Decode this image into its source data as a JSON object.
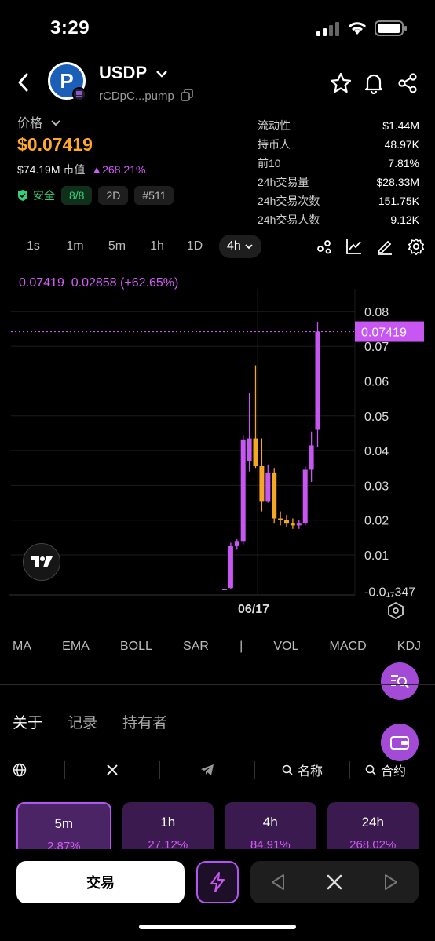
{
  "status_bar": {
    "time": "3:29"
  },
  "token": {
    "symbol": "USDP",
    "logo_letter": "P",
    "address": "rCDpC...pump"
  },
  "price": {
    "label": "价格",
    "value": "$0.07419",
    "market_cap": "$74.19M",
    "market_cap_label": "市值",
    "change": "268.21%"
  },
  "badges": {
    "safe_label": "安全",
    "safe_count": "8/8",
    "age": "2D",
    "rank": "#511"
  },
  "stats": [
    {
      "key": "流动性",
      "value": "$1.44M"
    },
    {
      "key": "持币人",
      "value": "48.97K"
    },
    {
      "key": "前10",
      "value": "7.81%"
    },
    {
      "key": "24h交易量",
      "value": "$28.33M"
    },
    {
      "key": "24h交易次数",
      "value": "151.75K"
    },
    {
      "key": "24h交易人数",
      "value": "9.12K"
    }
  ],
  "timeframes": [
    "1s",
    "1m",
    "5m",
    "1h",
    "1D",
    "4h"
  ],
  "active_timeframe": "4h",
  "chart_header": {
    "price": "0.07419",
    "change_abs": "0.02858",
    "change_pct": "(+62.65%)"
  },
  "chart_data": {
    "type": "candlestick",
    "y_ticks": [
      "0.08",
      "0.07",
      "0.06",
      "0.05",
      "0.04",
      "0.03",
      "0.02",
      "0.01"
    ],
    "y_tick_values": [
      0.08,
      0.07,
      0.06,
      0.05,
      0.04,
      0.03,
      0.02,
      0.01
    ],
    "y_bottom_label": "-0.0₁₇347",
    "current_price_label": "0.07419",
    "current_price": 0.07419,
    "x_label": "06/17",
    "ylim": [
      -0.0015,
      0.0865
    ],
    "candles": [
      {
        "o": 0.0002,
        "h": 0.0003,
        "l": 0.0001,
        "c": 0.0002
      },
      {
        "o": 0.0005,
        "h": 0.0135,
        "l": 0.0003,
        "c": 0.0125
      },
      {
        "o": 0.0125,
        "h": 0.0145,
        "l": 0.0115,
        "c": 0.014
      },
      {
        "o": 0.014,
        "h": 0.0445,
        "l": 0.013,
        "c": 0.043
      },
      {
        "o": 0.037,
        "h": 0.0565,
        "l": 0.034,
        "c": 0.0435
      },
      {
        "o": 0.0435,
        "h": 0.0645,
        "l": 0.035,
        "c": 0.0355
      },
      {
        "o": 0.0355,
        "h": 0.0435,
        "l": 0.0225,
        "c": 0.0255
      },
      {
        "o": 0.0255,
        "h": 0.036,
        "l": 0.025,
        "c": 0.0335
      },
      {
        "o": 0.0335,
        "h": 0.035,
        "l": 0.019,
        "c": 0.0205
      },
      {
        "o": 0.0205,
        "h": 0.0225,
        "l": 0.0185,
        "c": 0.02
      },
      {
        "o": 0.02,
        "h": 0.0215,
        "l": 0.018,
        "c": 0.019
      },
      {
        "o": 0.019,
        "h": 0.0205,
        "l": 0.0175,
        "c": 0.0185
      },
      {
        "o": 0.0185,
        "h": 0.02,
        "l": 0.0175,
        "c": 0.019
      },
      {
        "o": 0.019,
        "h": 0.0355,
        "l": 0.0185,
        "c": 0.0345
      },
      {
        "o": 0.0345,
        "h": 0.0455,
        "l": 0.031,
        "c": 0.0415
      },
      {
        "o": 0.046,
        "h": 0.077,
        "l": 0.041,
        "c": 0.0742
      }
    ]
  },
  "indicators": [
    "MA",
    "EMA",
    "BOLL",
    "SAR",
    "|",
    "VOL",
    "MACD",
    "KDJ"
  ],
  "tabs": [
    "关于",
    "记录",
    "持有者"
  ],
  "links": {
    "search_name": "名称",
    "search_contract": "合约"
  },
  "period_cards": [
    {
      "label": "5m",
      "pct": "2.87%"
    },
    {
      "label": "1h",
      "pct": "27.12%"
    },
    {
      "label": "4h",
      "pct": "84.91%"
    },
    {
      "label": "24h",
      "pct": "268.02%"
    }
  ],
  "bottom": {
    "trade_label": "交易"
  },
  "colors": {
    "up": "#c856f2",
    "down": "#f5a623",
    "price": "#ffa927",
    "safe": "#33d17a"
  }
}
